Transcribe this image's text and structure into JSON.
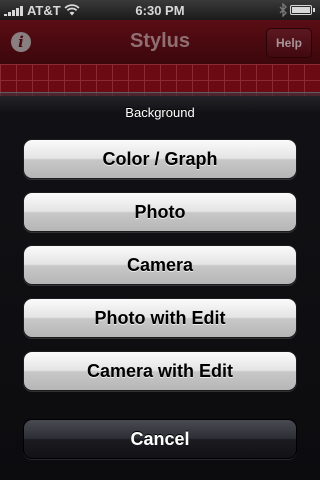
{
  "status_bar": {
    "carrier": "AT&T",
    "time": "6:30 PM"
  },
  "navbar": {
    "info_label": "i",
    "title": "Stylus",
    "help_label": "Help"
  },
  "action_sheet": {
    "title": "Background",
    "buttons": [
      {
        "label": "Color / Graph"
      },
      {
        "label": "Photo"
      },
      {
        "label": "Camera"
      },
      {
        "label": "Photo with Edit"
      },
      {
        "label": "Camera with Edit"
      }
    ],
    "cancel_label": "Cancel"
  },
  "colors": {
    "nav_tint": "#5a0d14",
    "grid_background": "#6c0a13",
    "grid_line": "#8b2a33",
    "sheet_background": "#0c0c0f"
  }
}
